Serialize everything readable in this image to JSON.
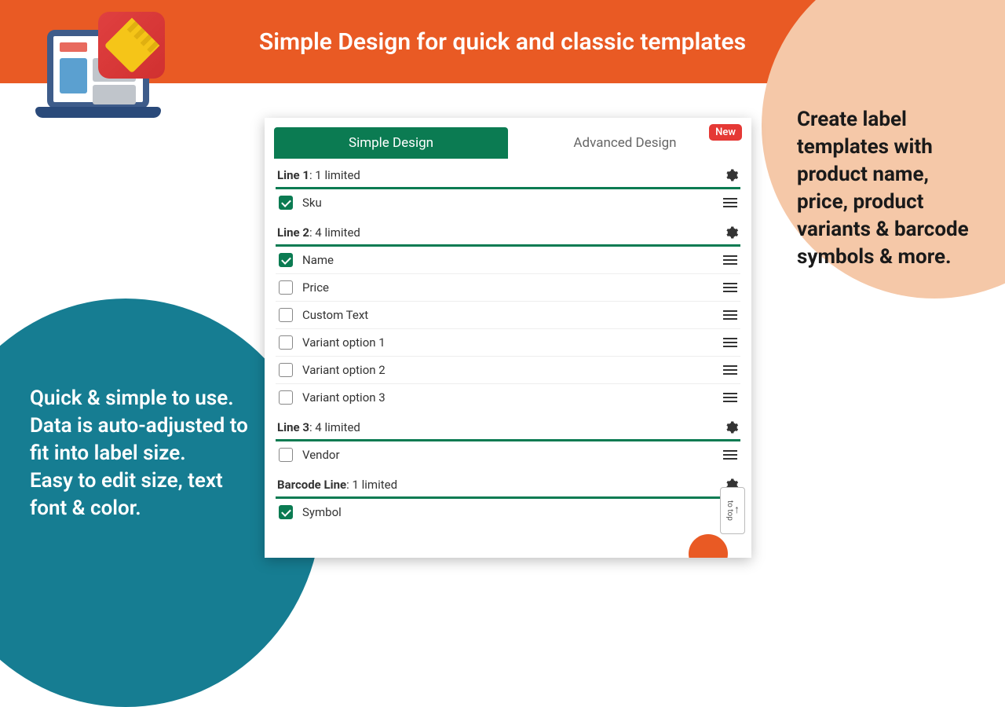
{
  "header": {
    "title": "Simple Design for quick and classic templates"
  },
  "tabs": {
    "simple": "Simple Design",
    "advanced": "Advanced Design",
    "new_badge": "New"
  },
  "lines": {
    "line1": {
      "label": "Line 1",
      "limit": ": 1 limited",
      "items": [
        {
          "label": "Sku",
          "checked": true
        }
      ]
    },
    "line2": {
      "label": "Line 2",
      "limit": ": 4 limited",
      "items": [
        {
          "label": "Name",
          "checked": true
        },
        {
          "label": "Price",
          "checked": false
        },
        {
          "label": "Custom Text",
          "checked": false
        },
        {
          "label": "Variant option 1",
          "checked": false
        },
        {
          "label": "Variant option 2",
          "checked": false
        },
        {
          "label": "Variant option 3",
          "checked": false
        }
      ]
    },
    "line3": {
      "label": "Line 3",
      "limit": ": 4 limited",
      "items": [
        {
          "label": "Vendor",
          "checked": false
        }
      ]
    },
    "barcode": {
      "label": "Barcode Line",
      "limit": ": 1 limited",
      "items": [
        {
          "label": "Symbol",
          "checked": true
        }
      ]
    }
  },
  "left_text": "Quick & simple to use.\nData is auto-adjusted to fit into label size.\nEasy to edit size, text font & color.",
  "right_text": "Create label templates with product name, price, product variants & barcode symbols & more.",
  "to_top": "to top"
}
